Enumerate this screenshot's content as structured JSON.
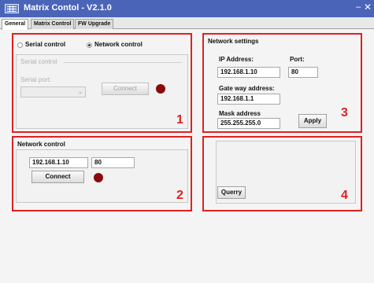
{
  "window": {
    "title": "Matrix Contol - V2.1.0",
    "minimize": "–",
    "close": "✕"
  },
  "tabs": [
    {
      "label": "General",
      "active": true
    },
    {
      "label": "Matrix Control",
      "active": false
    },
    {
      "label": "FW Upgrade",
      "active": false
    }
  ],
  "panel1": {
    "serial_radio_label": "Serial control",
    "network_radio_label": "Network control",
    "selected_mode": "Network control",
    "serial_group_title": "Serial control",
    "serial_port_label": "Serial port:",
    "serial_port_value": "",
    "connect_label": "Connect",
    "number": "1"
  },
  "panel2": {
    "title": "Network control",
    "ip_value": "192.168.1.10",
    "port_value": "80",
    "connect_label": "Connect",
    "number": "2"
  },
  "panel3": {
    "title": "Network settings",
    "ip_label": "IP Address:",
    "ip_value": "192.168.1.10",
    "port_label": "Port:",
    "port_value": "80",
    "gateway_label": "Gate way address:",
    "gateway_value": "192.168.1.1",
    "mask_label": "Mask address",
    "mask_value": "255.255.255.0",
    "apply_label": "Apply",
    "number": "3"
  },
  "panel4": {
    "query_label": "Querry",
    "number": "4"
  },
  "colors": {
    "titlebar": "#4a64b8",
    "highlight": "#e02020",
    "led": "#8b0a0a"
  }
}
